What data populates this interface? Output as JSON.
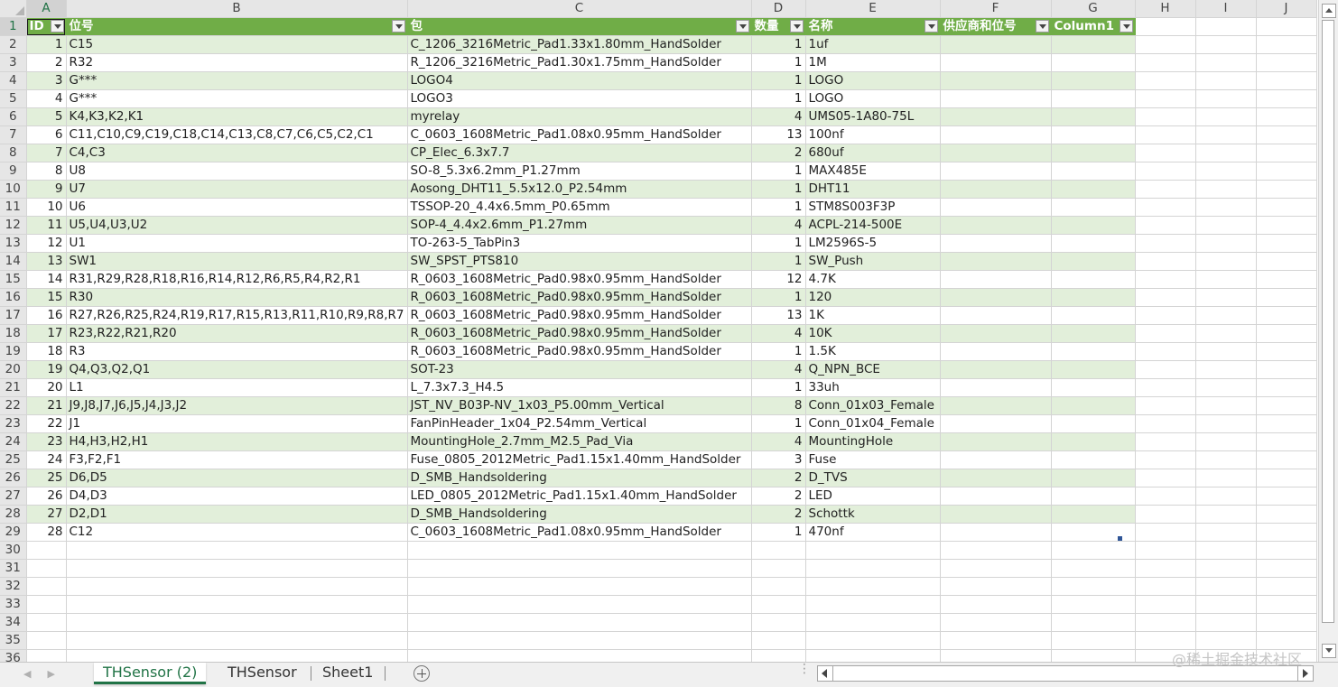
{
  "columns": [
    "A",
    "B",
    "C",
    "D",
    "E",
    "F",
    "G",
    "H",
    "I",
    "J"
  ],
  "selected_column": "A",
  "selected_row": 1,
  "table_headers": [
    "ID",
    "位号",
    "包",
    "数量",
    "名称",
    "供应商和位号",
    "Column1"
  ],
  "rows": [
    [
      "1",
      "C15",
      "C_1206_3216Metric_Pad1.33x1.80mm_HandSolder",
      "1",
      "1uf",
      "",
      ""
    ],
    [
      "2",
      "R32",
      "R_1206_3216Metric_Pad1.30x1.75mm_HandSolder",
      "1",
      "1M",
      "",
      ""
    ],
    [
      "3",
      "G***",
      "LOGO4",
      "1",
      "LOGO",
      "",
      ""
    ],
    [
      "4",
      "G***",
      "LOGO3",
      "1",
      "LOGO",
      "",
      ""
    ],
    [
      "5",
      "K4,K3,K2,K1",
      "myrelay",
      "4",
      "UMS05-1A80-75L",
      "",
      ""
    ],
    [
      "6",
      "C11,C10,C9,C19,C18,C14,C13,C8,C7,C6,C5,C2,C1",
      "C_0603_1608Metric_Pad1.08x0.95mm_HandSolder",
      "13",
      "100nf",
      "",
      ""
    ],
    [
      "7",
      "C4,C3",
      "CP_Elec_6.3x7.7",
      "2",
      "680uf",
      "",
      ""
    ],
    [
      "8",
      "U8",
      "SO-8_5.3x6.2mm_P1.27mm",
      "1",
      "MAX485E",
      "",
      ""
    ],
    [
      "9",
      "U7",
      "Aosong_DHT11_5.5x12.0_P2.54mm",
      "1",
      "DHT11",
      "",
      ""
    ],
    [
      "10",
      "U6",
      "TSSOP-20_4.4x6.5mm_P0.65mm",
      "1",
      "STM8S003F3P",
      "",
      ""
    ],
    [
      "11",
      "U5,U4,U3,U2",
      "SOP-4_4.4x2.6mm_P1.27mm",
      "4",
      "ACPL-214-500E",
      "",
      ""
    ],
    [
      "12",
      "U1",
      "TO-263-5_TabPin3",
      "1",
      "LM2596S-5",
      "",
      ""
    ],
    [
      "13",
      "SW1",
      "SW_SPST_PTS810",
      "1",
      "SW_Push",
      "",
      ""
    ],
    [
      "14",
      "R31,R29,R28,R18,R16,R14,R12,R6,R5,R4,R2,R1",
      "R_0603_1608Metric_Pad0.98x0.95mm_HandSolder",
      "12",
      "4.7K",
      "",
      ""
    ],
    [
      "15",
      "R30",
      "R_0603_1608Metric_Pad0.98x0.95mm_HandSolder",
      "1",
      "120",
      "",
      ""
    ],
    [
      "16",
      "R27,R26,R25,R24,R19,R17,R15,R13,R11,R10,R9,R8,R7",
      "R_0603_1608Metric_Pad0.98x0.95mm_HandSolder",
      "13",
      "1K",
      "",
      ""
    ],
    [
      "17",
      "R23,R22,R21,R20",
      "R_0603_1608Metric_Pad0.98x0.95mm_HandSolder",
      "4",
      "10K",
      "",
      ""
    ],
    [
      "18",
      "R3",
      "R_0603_1608Metric_Pad0.98x0.95mm_HandSolder",
      "1",
      "1.5K",
      "",
      ""
    ],
    [
      "19",
      "Q4,Q3,Q2,Q1",
      "SOT-23",
      "4",
      "Q_NPN_BCE",
      "",
      ""
    ],
    [
      "20",
      "L1",
      "L_7.3x7.3_H4.5",
      "1",
      "33uh",
      "",
      ""
    ],
    [
      "21",
      "J9,J8,J7,J6,J5,J4,J3,J2",
      "JST_NV_B03P-NV_1x03_P5.00mm_Vertical",
      "8",
      "Conn_01x03_Female",
      "",
      ""
    ],
    [
      "22",
      "J1",
      "FanPinHeader_1x04_P2.54mm_Vertical",
      "1",
      "Conn_01x04_Female",
      "",
      ""
    ],
    [
      "23",
      "H4,H3,H2,H1",
      "MountingHole_2.7mm_M2.5_Pad_Via",
      "4",
      "MountingHole",
      "",
      ""
    ],
    [
      "24",
      "F3,F2,F1",
      "Fuse_0805_2012Metric_Pad1.15x1.40mm_HandSolder",
      "3",
      "Fuse",
      "",
      ""
    ],
    [
      "25",
      "D6,D5",
      "D_SMB_Handsoldering",
      "2",
      "D_TVS",
      "",
      ""
    ],
    [
      "26",
      "D4,D3",
      "LED_0805_2012Metric_Pad1.15x1.40mm_HandSolder",
      "2",
      "LED",
      "",
      ""
    ],
    [
      "27",
      "D2,D1",
      "D_SMB_Handsoldering",
      "2",
      "Schottk",
      "",
      ""
    ],
    [
      "28",
      "C12",
      "C_0603_1608Metric_Pad1.08x0.95mm_HandSolder",
      "1",
      "470nf",
      "",
      ""
    ]
  ],
  "empty_row_numbers": [
    "30",
    "31",
    "32",
    "33",
    "34",
    "35",
    "36"
  ],
  "sheet_tabs": [
    {
      "label": "THSensor (2)",
      "active": true
    },
    {
      "label": "THSensor",
      "active": false
    },
    {
      "label": "Sheet1",
      "active": false
    }
  ],
  "watermark": "@稀土掘金技术社区",
  "colors": {
    "table_header": "#70ad47",
    "band": "#e2efda",
    "accent": "#217346"
  }
}
